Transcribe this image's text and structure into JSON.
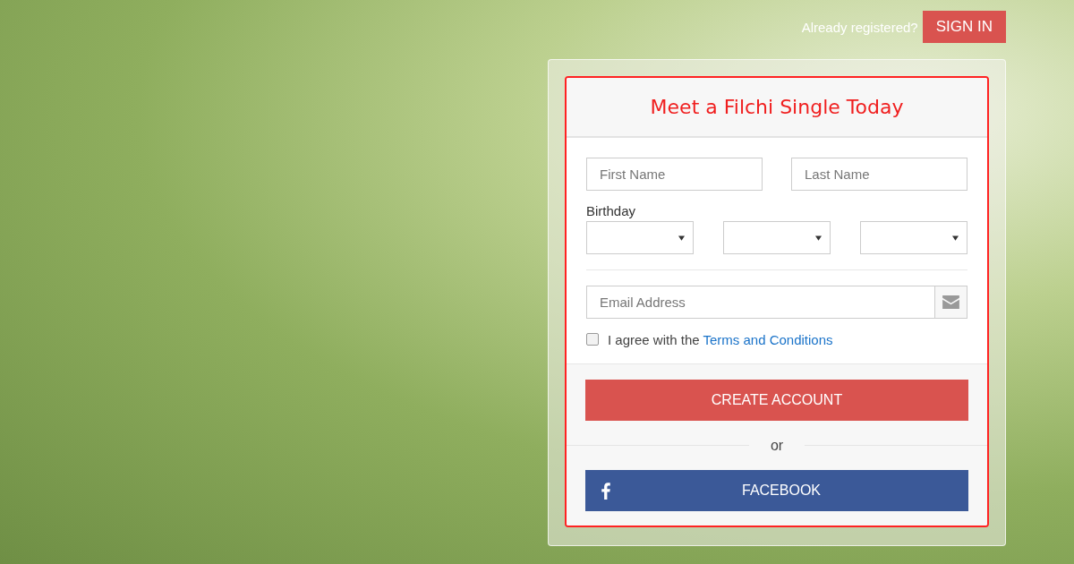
{
  "header": {
    "prompt": "Already registered?",
    "sign_in_button": "SIGN IN"
  },
  "form": {
    "title": "Meet a Filchi Single Today",
    "first_name": {
      "placeholder": "First Name"
    },
    "last_name": {
      "placeholder": "Last Name"
    },
    "birthday": {
      "label": "Birthday",
      "selects": [
        {
          "kind": "dropdown"
        },
        {
          "kind": "dropdown"
        },
        {
          "kind": "dropdown"
        }
      ]
    },
    "email": {
      "placeholder": "Email Address"
    },
    "agree": {
      "checked": false,
      "text": "I agree with the ",
      "link": "Terms and Conditions"
    },
    "create_button": "CREATE ACCOUNT",
    "separator": "or",
    "facebook_button": "FACEBOOK"
  }
}
